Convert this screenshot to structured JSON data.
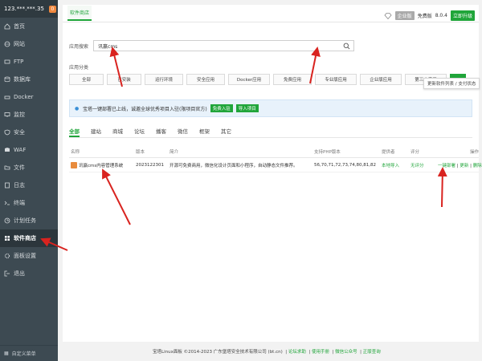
{
  "sidebar": {
    "host": "123.***.***.35",
    "badge": "0",
    "items": [
      {
        "label": "首页",
        "icon": "home-icon"
      },
      {
        "label": "网站",
        "icon": "globe-icon"
      },
      {
        "label": "FTP",
        "icon": "ftp-icon"
      },
      {
        "label": "数据库",
        "icon": "database-icon"
      },
      {
        "label": "Docker",
        "icon": "docker-icon"
      },
      {
        "label": "监控",
        "icon": "monitor-icon"
      },
      {
        "label": "安全",
        "icon": "shield-icon"
      },
      {
        "label": "WAF",
        "icon": "waf-icon"
      },
      {
        "label": "文件",
        "icon": "folder-icon"
      },
      {
        "label": "日志",
        "icon": "log-icon"
      },
      {
        "label": "终端",
        "icon": "terminal-icon"
      },
      {
        "label": "计划任务",
        "icon": "clock-icon"
      },
      {
        "label": "软件商店",
        "icon": "store-icon"
      },
      {
        "label": "面板设置",
        "icon": "gear-icon"
      },
      {
        "label": "退出",
        "icon": "logout-icon"
      }
    ],
    "custom_menu": "自定义菜单"
  },
  "header": {
    "tab": "软件商店",
    "vip": "企业版",
    "free_label": "免费版",
    "version": "8.0.4",
    "upgrade": "立即升级"
  },
  "search": {
    "label": "应用搜索",
    "value": "讯赢cms"
  },
  "categories": {
    "label": "应用分类",
    "items": [
      "全部",
      "已安装",
      "运行环境",
      "安全应用",
      "Docker应用",
      "免费应用",
      "专业版应用",
      "企业版应用",
      "第三方应用"
    ],
    "tooltip": "更新软件列表 / 支付状态"
  },
  "notice": {
    "text": "宝塔一键部署已上线，诚邀全球优秀项目入驻(限项目官方)",
    "btn1": "免费入驻",
    "btn2": "导入项目"
  },
  "filter_tabs": [
    "全部",
    "建站",
    "商城",
    "论坛",
    "播客",
    "微信",
    "框架",
    "其它"
  ],
  "table": {
    "headers": [
      "名称",
      "版本",
      "简介",
      "支持PHP版本",
      "提供者",
      "评分",
      "操作"
    ],
    "rows": [
      {
        "name": "讯赢cms内容管理系统",
        "version": "2023122301",
        "desc": "开源可免费商用，微信化设计页面和小程序，自动静态文件推荐。",
        "php": "56,70,71,72,73,74,80,81,82",
        "provider": "本地导入",
        "rating": "无评分",
        "actions": [
          "一键部署",
          "更新",
          "删除"
        ]
      }
    ]
  },
  "footer": {
    "copyright": "宝塔Linux面板 ©2014-2023 广东堡塔安全技术有限公司 (bt.cn)",
    "links": [
      "论坛求助",
      "使用手册",
      "微信公众号",
      "正版查询"
    ]
  },
  "colors": {
    "accent": "#20a53a",
    "sidebar": "#3d4a52",
    "arrow": "#d9231f"
  }
}
